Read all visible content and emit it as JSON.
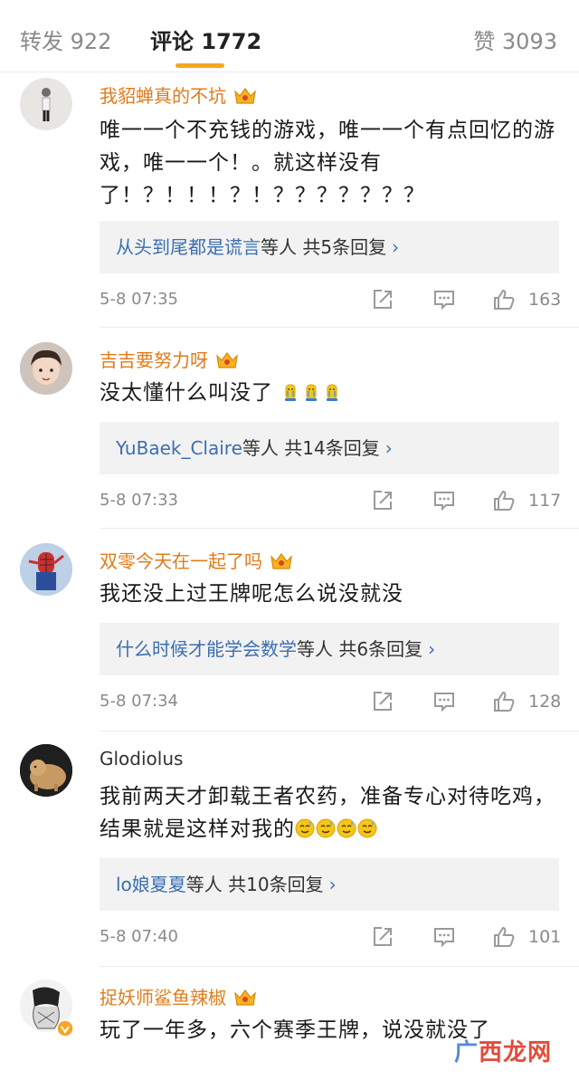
{
  "tabs": {
    "repost_label": "转发 922",
    "comments_label": "评论 1772",
    "likes_label": "赞 3093"
  },
  "comments": [
    {
      "username": "我貂蝉真的不坑",
      "text": "唯一一个不充钱的游戏，唯一一个有点回忆的游戏，唯一一个！。就这样没有了！？！！！？！？？？？？？？",
      "reply_link": "从头到尾都是谎言",
      "reply_suffix": "等人  共5条回复",
      "time": "5-8 07:35",
      "likes": "163"
    },
    {
      "username": "吉吉要努力呀",
      "text": "没太懂什么叫没了",
      "reply_link": "YuBaek_Claire",
      "reply_suffix": "等人  共14条回复",
      "time": "5-8 07:33",
      "likes": "117"
    },
    {
      "username": "双零今天在一起了吗",
      "text": "我还没上过王牌呢怎么说没就没",
      "reply_link": "什么时候才能学会数学",
      "reply_suffix": "等人  共6条回复",
      "time": "5-8 07:34",
      "likes": "128"
    },
    {
      "username": "Glodiolus",
      "text": "我前两天才卸载王者农药，准备专心对待吃鸡，结果就是这样对我的",
      "reply_link": "lo娘夏夏",
      "reply_suffix": "等人  共10条回复",
      "time": "5-8 07:40",
      "likes": "101"
    },
    {
      "username": "捉妖师鲨鱼辣椒",
      "text": "玩了一年多，六个赛季王牌，说没就没了"
    }
  ],
  "icons": {
    "share": "share-icon",
    "reply": "comment-icon",
    "like": "thumbs-up-icon",
    "crown": "vip-crown-icon"
  },
  "colors": {
    "accent": "#f5a623",
    "username": "#e07c1a",
    "link": "#3a6fb0"
  },
  "watermark": {
    "mark": "广",
    "text": "西龙网"
  }
}
